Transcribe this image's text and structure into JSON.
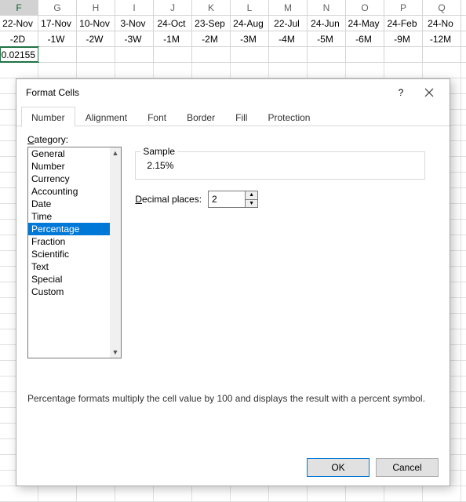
{
  "grid": {
    "columns": [
      "F",
      "G",
      "H",
      "I",
      "J",
      "K",
      "L",
      "M",
      "N",
      "O",
      "P",
      "Q"
    ],
    "selected_column": "F",
    "rows": [
      [
        "22-Nov",
        "17-Nov",
        "10-Nov",
        "3-Nov",
        "24-Oct",
        "23-Sep",
        "24-Aug",
        "22-Jul",
        "24-Jun",
        "24-May",
        "24-Feb",
        "24-No"
      ],
      [
        "-2D",
        "-1W",
        "-2W",
        "-3W",
        "-1M",
        "-2M",
        "-3M",
        "-4M",
        "-5M",
        "-6M",
        "-9M",
        "-12M"
      ],
      [
        "0.02155",
        "",
        "",
        "",
        "",
        "",
        "",
        "",
        "",
        "",
        "",
        ""
      ]
    ],
    "active_cell": {
      "row": 2,
      "col": 0
    }
  },
  "dialog": {
    "title": "Format Cells",
    "help_label": "?",
    "tabs": [
      "Number",
      "Alignment",
      "Font",
      "Border",
      "Fill",
      "Protection"
    ],
    "active_tab": 0,
    "category_label": "Category:",
    "categories": [
      "General",
      "Number",
      "Currency",
      "Accounting",
      "Date",
      "Time",
      "Percentage",
      "Fraction",
      "Scientific",
      "Text",
      "Special",
      "Custom"
    ],
    "selected_category": 6,
    "sample_label": "Sample",
    "sample_value": "2.15%",
    "decimal_label": "Decimal places:",
    "decimal_value": "2",
    "description": "Percentage formats multiply the cell value by 100 and displays the result with a percent symbol.",
    "ok_label": "OK",
    "cancel_label": "Cancel"
  }
}
